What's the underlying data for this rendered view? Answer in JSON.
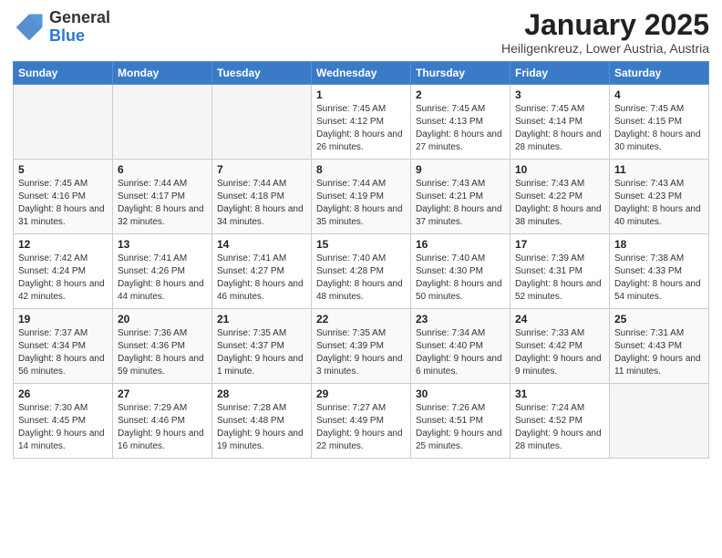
{
  "header": {
    "logo_general": "General",
    "logo_blue": "Blue",
    "month_title": "January 2025",
    "location": "Heiligenkreuz, Lower Austria, Austria"
  },
  "weekdays": [
    "Sunday",
    "Monday",
    "Tuesday",
    "Wednesday",
    "Thursday",
    "Friday",
    "Saturday"
  ],
  "weeks": [
    [
      {
        "day": "",
        "sunrise": "",
        "sunset": "",
        "daylight": "",
        "empty": true
      },
      {
        "day": "",
        "sunrise": "",
        "sunset": "",
        "daylight": "",
        "empty": true
      },
      {
        "day": "",
        "sunrise": "",
        "sunset": "",
        "daylight": "",
        "empty": true
      },
      {
        "day": "1",
        "sunrise": "Sunrise: 7:45 AM",
        "sunset": "Sunset: 4:12 PM",
        "daylight": "Daylight: 8 hours and 26 minutes."
      },
      {
        "day": "2",
        "sunrise": "Sunrise: 7:45 AM",
        "sunset": "Sunset: 4:13 PM",
        "daylight": "Daylight: 8 hours and 27 minutes."
      },
      {
        "day": "3",
        "sunrise": "Sunrise: 7:45 AM",
        "sunset": "Sunset: 4:14 PM",
        "daylight": "Daylight: 8 hours and 28 minutes."
      },
      {
        "day": "4",
        "sunrise": "Sunrise: 7:45 AM",
        "sunset": "Sunset: 4:15 PM",
        "daylight": "Daylight: 8 hours and 30 minutes."
      }
    ],
    [
      {
        "day": "5",
        "sunrise": "Sunrise: 7:45 AM",
        "sunset": "Sunset: 4:16 PM",
        "daylight": "Daylight: 8 hours and 31 minutes."
      },
      {
        "day": "6",
        "sunrise": "Sunrise: 7:44 AM",
        "sunset": "Sunset: 4:17 PM",
        "daylight": "Daylight: 8 hours and 32 minutes."
      },
      {
        "day": "7",
        "sunrise": "Sunrise: 7:44 AM",
        "sunset": "Sunset: 4:18 PM",
        "daylight": "Daylight: 8 hours and 34 minutes."
      },
      {
        "day": "8",
        "sunrise": "Sunrise: 7:44 AM",
        "sunset": "Sunset: 4:19 PM",
        "daylight": "Daylight: 8 hours and 35 minutes."
      },
      {
        "day": "9",
        "sunrise": "Sunrise: 7:43 AM",
        "sunset": "Sunset: 4:21 PM",
        "daylight": "Daylight: 8 hours and 37 minutes."
      },
      {
        "day": "10",
        "sunrise": "Sunrise: 7:43 AM",
        "sunset": "Sunset: 4:22 PM",
        "daylight": "Daylight: 8 hours and 38 minutes."
      },
      {
        "day": "11",
        "sunrise": "Sunrise: 7:43 AM",
        "sunset": "Sunset: 4:23 PM",
        "daylight": "Daylight: 8 hours and 40 minutes."
      }
    ],
    [
      {
        "day": "12",
        "sunrise": "Sunrise: 7:42 AM",
        "sunset": "Sunset: 4:24 PM",
        "daylight": "Daylight: 8 hours and 42 minutes."
      },
      {
        "day": "13",
        "sunrise": "Sunrise: 7:41 AM",
        "sunset": "Sunset: 4:26 PM",
        "daylight": "Daylight: 8 hours and 44 minutes."
      },
      {
        "day": "14",
        "sunrise": "Sunrise: 7:41 AM",
        "sunset": "Sunset: 4:27 PM",
        "daylight": "Daylight: 8 hours and 46 minutes."
      },
      {
        "day": "15",
        "sunrise": "Sunrise: 7:40 AM",
        "sunset": "Sunset: 4:28 PM",
        "daylight": "Daylight: 8 hours and 48 minutes."
      },
      {
        "day": "16",
        "sunrise": "Sunrise: 7:40 AM",
        "sunset": "Sunset: 4:30 PM",
        "daylight": "Daylight: 8 hours and 50 minutes."
      },
      {
        "day": "17",
        "sunrise": "Sunrise: 7:39 AM",
        "sunset": "Sunset: 4:31 PM",
        "daylight": "Daylight: 8 hours and 52 minutes."
      },
      {
        "day": "18",
        "sunrise": "Sunrise: 7:38 AM",
        "sunset": "Sunset: 4:33 PM",
        "daylight": "Daylight: 8 hours and 54 minutes."
      }
    ],
    [
      {
        "day": "19",
        "sunrise": "Sunrise: 7:37 AM",
        "sunset": "Sunset: 4:34 PM",
        "daylight": "Daylight: 8 hours and 56 minutes."
      },
      {
        "day": "20",
        "sunrise": "Sunrise: 7:36 AM",
        "sunset": "Sunset: 4:36 PM",
        "daylight": "Daylight: 8 hours and 59 minutes."
      },
      {
        "day": "21",
        "sunrise": "Sunrise: 7:35 AM",
        "sunset": "Sunset: 4:37 PM",
        "daylight": "Daylight: 9 hours and 1 minute."
      },
      {
        "day": "22",
        "sunrise": "Sunrise: 7:35 AM",
        "sunset": "Sunset: 4:39 PM",
        "daylight": "Daylight: 9 hours and 3 minutes."
      },
      {
        "day": "23",
        "sunrise": "Sunrise: 7:34 AM",
        "sunset": "Sunset: 4:40 PM",
        "daylight": "Daylight: 9 hours and 6 minutes."
      },
      {
        "day": "24",
        "sunrise": "Sunrise: 7:33 AM",
        "sunset": "Sunset: 4:42 PM",
        "daylight": "Daylight: 9 hours and 9 minutes."
      },
      {
        "day": "25",
        "sunrise": "Sunrise: 7:31 AM",
        "sunset": "Sunset: 4:43 PM",
        "daylight": "Daylight: 9 hours and 11 minutes."
      }
    ],
    [
      {
        "day": "26",
        "sunrise": "Sunrise: 7:30 AM",
        "sunset": "Sunset: 4:45 PM",
        "daylight": "Daylight: 9 hours and 14 minutes."
      },
      {
        "day": "27",
        "sunrise": "Sunrise: 7:29 AM",
        "sunset": "Sunset: 4:46 PM",
        "daylight": "Daylight: 9 hours and 16 minutes."
      },
      {
        "day": "28",
        "sunrise": "Sunrise: 7:28 AM",
        "sunset": "Sunset: 4:48 PM",
        "daylight": "Daylight: 9 hours and 19 minutes."
      },
      {
        "day": "29",
        "sunrise": "Sunrise: 7:27 AM",
        "sunset": "Sunset: 4:49 PM",
        "daylight": "Daylight: 9 hours and 22 minutes."
      },
      {
        "day": "30",
        "sunrise": "Sunrise: 7:26 AM",
        "sunset": "Sunset: 4:51 PM",
        "daylight": "Daylight: 9 hours and 25 minutes."
      },
      {
        "day": "31",
        "sunrise": "Sunrise: 7:24 AM",
        "sunset": "Sunset: 4:52 PM",
        "daylight": "Daylight: 9 hours and 28 minutes."
      },
      {
        "day": "",
        "sunrise": "",
        "sunset": "",
        "daylight": "",
        "empty": true
      }
    ]
  ]
}
